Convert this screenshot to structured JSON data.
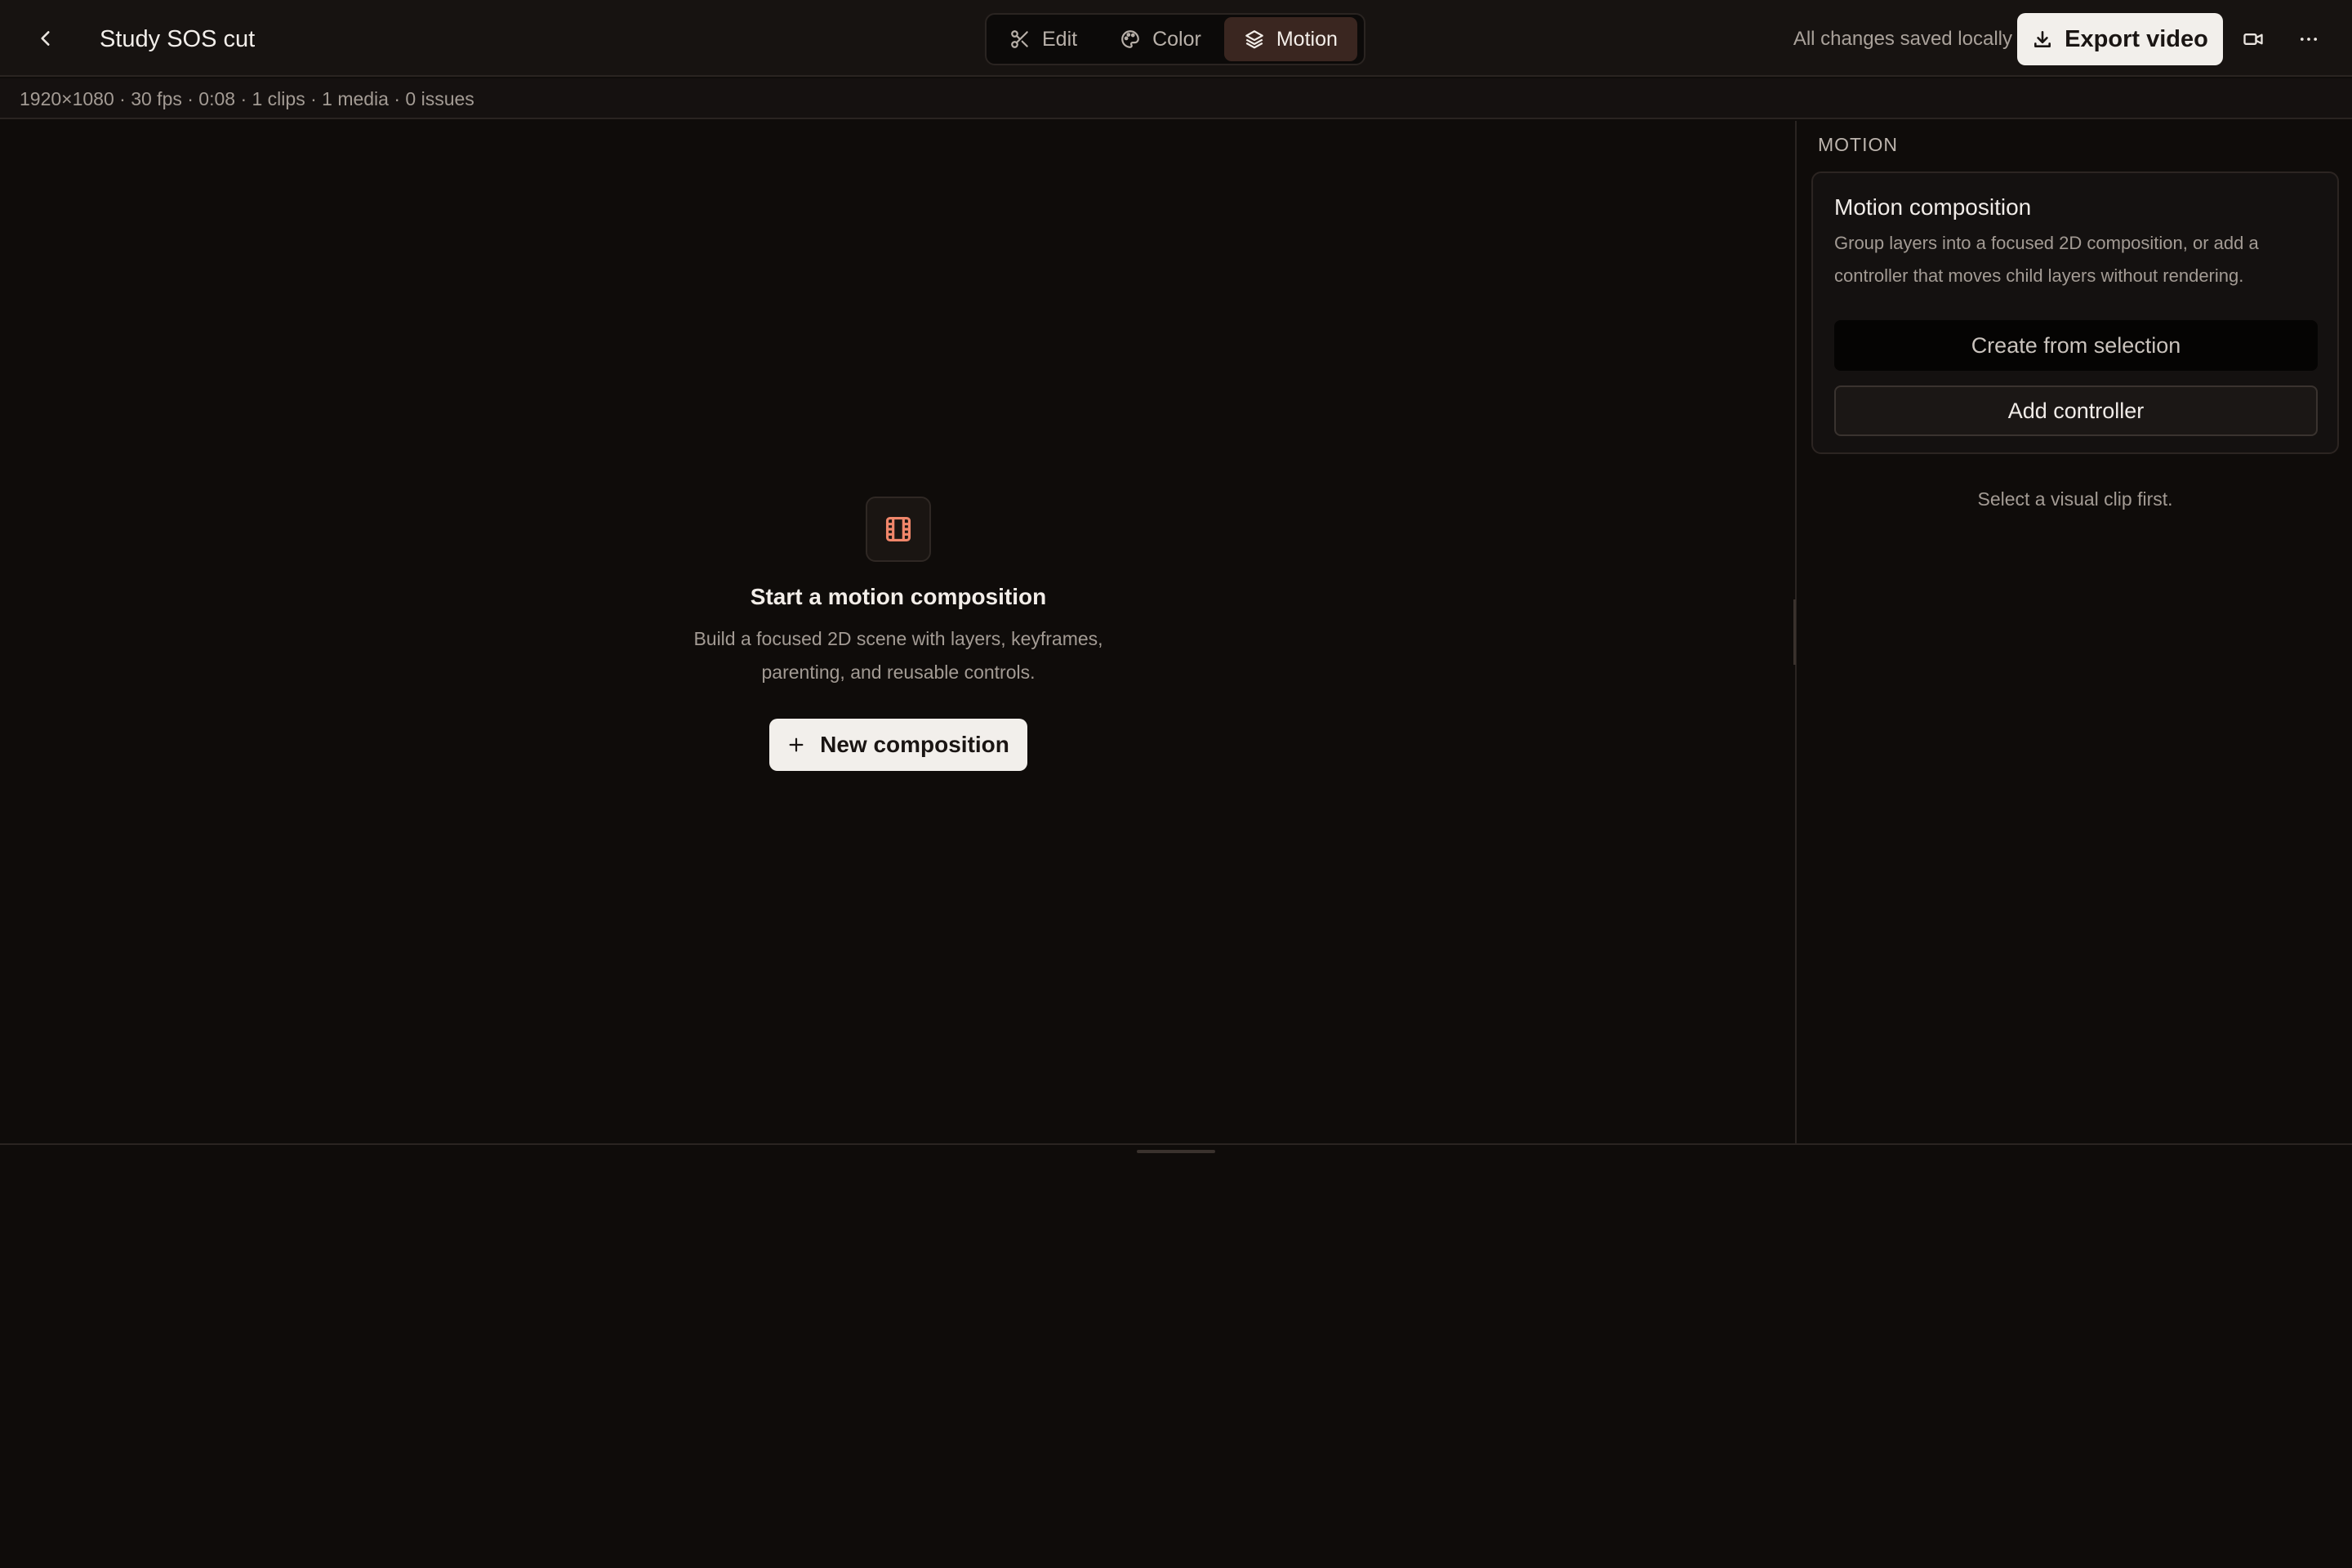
{
  "header": {
    "project_title": "Study SOS cut",
    "modes": [
      {
        "label": "Edit",
        "icon": "scissors-icon",
        "active": false
      },
      {
        "label": "Color",
        "icon": "palette-icon",
        "active": false
      },
      {
        "label": "Motion",
        "icon": "layers-icon",
        "active": true
      }
    ],
    "save_status": "All changes saved locally",
    "export_label": "Export video"
  },
  "meta": {
    "summary": "1920×1080 · 30 fps · 0:08 · 1 clips · 1 media · 0 issues"
  },
  "canvas": {
    "empty_icon": "film-icon",
    "empty_title": "Start a motion composition",
    "empty_desc_line1": "Build a focused 2D scene with layers, keyframes,",
    "empty_desc_line2": "parenting, and reusable controls.",
    "new_button": "New composition"
  },
  "panel": {
    "heading": "MOTION",
    "card_title": "Motion composition",
    "card_desc_line1": "Group layers into a focused 2D composition, or add a",
    "card_desc_line2": "controller that moves child layers without rendering.",
    "create_button": "Create from selection",
    "controller_button": "Add controller",
    "hint": "Select a visual clip first."
  },
  "colors": {
    "background": "#0f0c0a",
    "accent": "#f0866a",
    "active_tab": "#3a2620"
  }
}
